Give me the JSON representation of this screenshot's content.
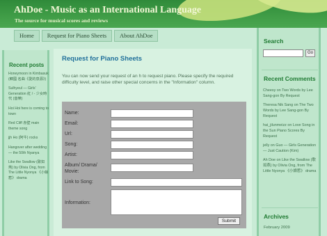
{
  "header": {
    "title": "AhDoe - Music as an International Language",
    "tagline": "The source for musical scores and reviews"
  },
  "nav": {
    "tabs": [
      "Home",
      "Request for Piano Sheets",
      "About AhDoe"
    ]
  },
  "left_sidebar": {
    "heading": "Recent posts",
    "items": [
      "Honeymoon in Kimbasuk (韓國 名曲《愛的泉源》)",
      "Sulhyeul — Girls' Generation 紅 / - 少女時代 (音樂)",
      "Hoi Hoi here is coming to town",
      "Red Cliff 赤壁 main theme song",
      "jjh Ho (阿牛) rocks",
      "Hangover after wedding — the 50th Nyanya",
      "Like the Swallow (歌如燕) by Olivia Ong, from The Little Nyonya 《小娘惹》 drama"
    ]
  },
  "main": {
    "title": "Request for Piano Sheets",
    "intro": "You can now send your request of an h to request piano. Please specify the required difficulty level, and raise other special concerns in the \"Information\" column."
  },
  "form": {
    "fields": [
      {
        "label": "Name:"
      },
      {
        "label": "Email:"
      },
      {
        "label": "Url:"
      },
      {
        "label": "Song:"
      },
      {
        "label": "Artist:"
      },
      {
        "label": "Album/ Drama/ Movie:"
      },
      {
        "label": "Link to Song:"
      },
      {
        "label": "Information:"
      }
    ],
    "submit_label": "Submit"
  },
  "right_sidebar": {
    "search_heading": "Search",
    "search_button": "Go",
    "comments_heading": "Recent Comments",
    "comments": [
      "Cheesy on Two Words by Lee Sang-gon By Request",
      "Theresa Nik Sang on The Two Words by Lee Sang-gon By Request",
      "hai_jilunmeizz on Love Song in the Sun Piano Scores By Request",
      "jelly on Guo — Girls Generation — Just Caution (Kim)",
      "Ah Doe on Like the Swallow (歌如燕) by Olivia Ong, from The Little Nyonya 《小娘惹》 drama"
    ],
    "archives_heading": "Archives",
    "archive_item": "February 2009"
  },
  "colors": {
    "header_green": "#3f9c46",
    "page_background": "#cfeede",
    "heading_green": "#1f7a32",
    "title_blue": "#1f6f9a",
    "form_gray": "#a8a8a8"
  }
}
